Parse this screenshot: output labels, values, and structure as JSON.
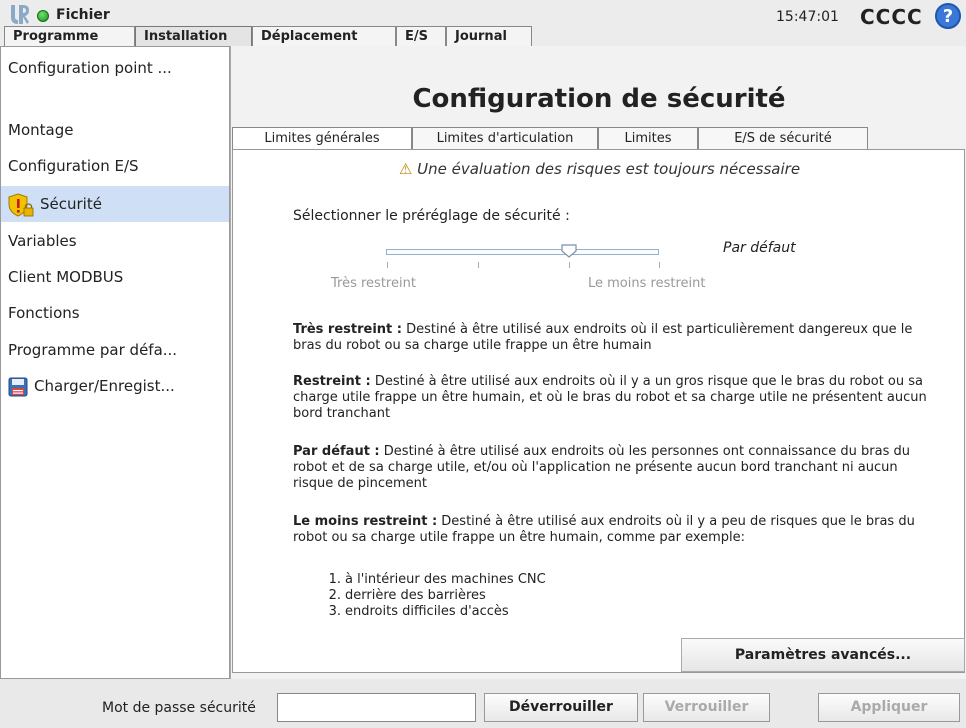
{
  "header": {
    "file_menu": "Fichier",
    "clock": "15:47:01",
    "robot_name": "CCCC",
    "help": "?"
  },
  "tabs": [
    {
      "label": "Programme"
    },
    {
      "label": "Installation"
    },
    {
      "label": "Déplacement"
    },
    {
      "label": "E/S"
    },
    {
      "label": "Journal"
    }
  ],
  "sidebar": {
    "items": [
      {
        "label": "Configuration point ..."
      },
      {
        "label": "Montage"
      },
      {
        "label": "Configuration E/S"
      },
      {
        "label": "Sécurité"
      },
      {
        "label": "Variables"
      },
      {
        "label": "Client MODBUS"
      },
      {
        "label": "Fonctions"
      },
      {
        "label": "Programme par défa..."
      },
      {
        "label": "Charger/Enregist..."
      }
    ]
  },
  "main": {
    "title": "Configuration de sécurité",
    "subtabs": [
      {
        "label": "Limites générales"
      },
      {
        "label": "Limites d'articulation"
      },
      {
        "label": "Limites"
      },
      {
        "label": "E/S de sécurité"
      }
    ],
    "warning": "Une évaluation des risques est toujours nécessaire",
    "preset_label": "Sélectionner le préréglage de sécurité :",
    "slider": {
      "value_label": "Par défaut",
      "min_label": "Très restreint",
      "max_label": "Le moins restreint",
      "level": 0.75
    },
    "descriptions": {
      "tres_title": "Très restreint :",
      "tres_text": "Destiné à être utilisé aux endroits où il est particulièrement dangereux que le bras du robot ou sa charge utile frappe un être humain",
      "restreint_title": "Restreint :",
      "restreint_text": "Destiné à être utilisé aux endroits où il y a un gros risque que le bras du robot ou sa charge utile frappe un être humain, et où le bras du robot et sa charge utile ne présentent aucun bord tranchant",
      "defaut_title": "Par défaut :",
      "defaut_text": "Destiné à être utilisé aux endroits où les personnes ont connaissance du bras du robot et de sa charge utile, et/ou où l'application ne présente aucun bord tranchant ni aucun risque de pincement",
      "moins_title": "Le moins restreint :",
      "moins_text": "Destiné à être utilisé aux endroits où il y a peu de risques que le bras du robot ou sa charge utile frappe un être humain, comme par exemple:"
    },
    "list": [
      {
        "num": "1.",
        "text": "à l'intérieur des machines CNC"
      },
      {
        "num": "2.",
        "text": "derrière des barrières"
      },
      {
        "num": "3.",
        "text": "endroits difficiles d'accès"
      }
    ],
    "advanced_button": "Paramètres avancés..."
  },
  "bottom": {
    "password_label": "Mot de passe sécurité",
    "password_value": "",
    "unlock": "Déverrouiller",
    "lock": "Verrouiller",
    "apply": "Appliquer"
  }
}
